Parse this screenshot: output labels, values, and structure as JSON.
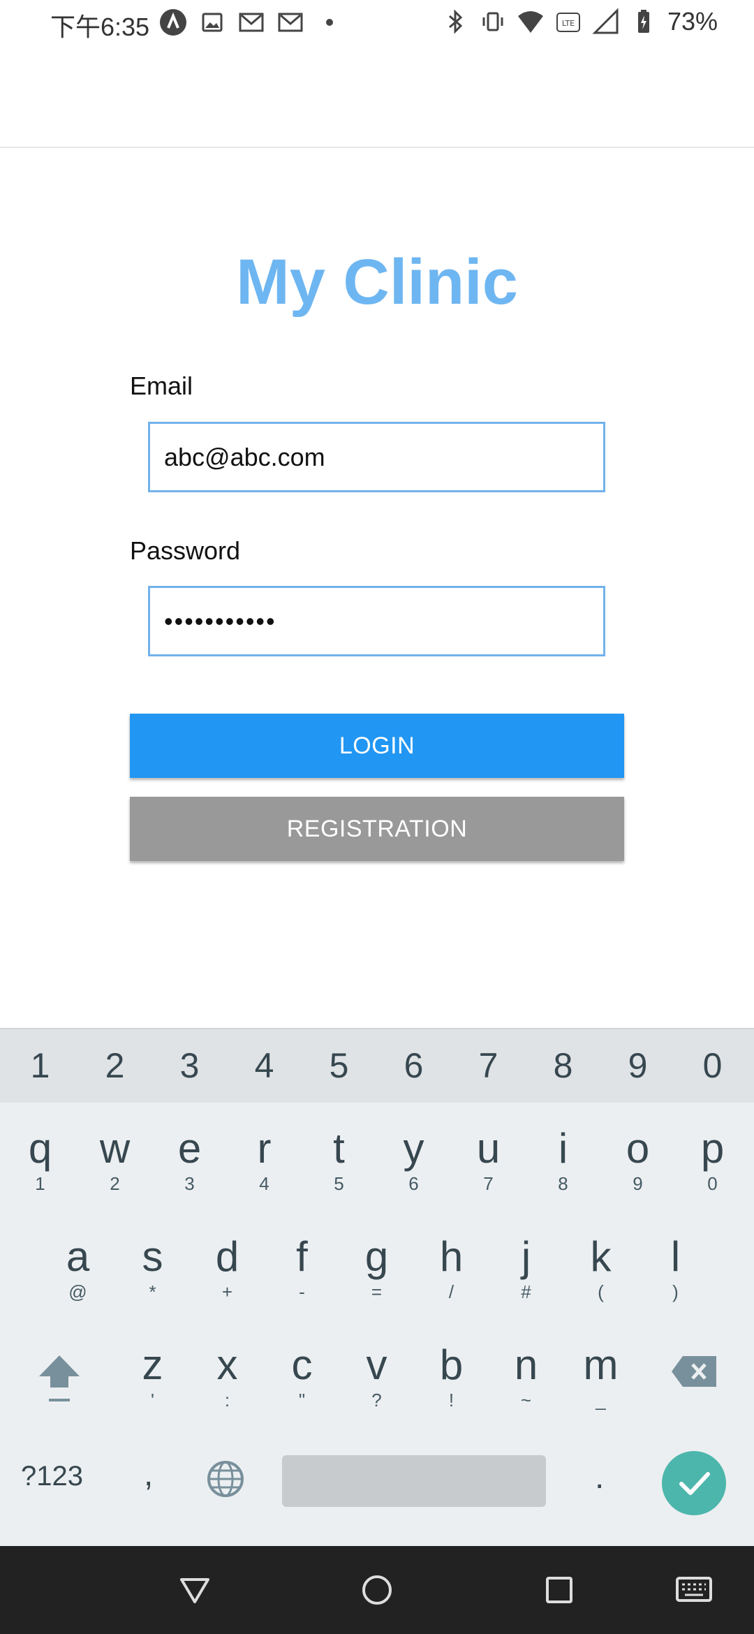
{
  "status_bar": {
    "time": "下午6:35",
    "battery": "73%",
    "left_icons": [
      "a-notification-icon",
      "image-icon",
      "gmail-icon",
      "gmail-icon",
      "dot-icon"
    ],
    "right_icons": [
      "bluetooth-icon",
      "vibrate-icon",
      "wifi-icon",
      "volte-icon",
      "signal-icon",
      "battery-icon"
    ]
  },
  "app": {
    "title": "My Clinic"
  },
  "form": {
    "email_label": "Email",
    "email_value": "abc@abc.com",
    "password_label": "Password",
    "password_value": "•••••••••••",
    "login_label": "LOGIN",
    "register_label": "REGISTRATION"
  },
  "keyboard": {
    "numbers": [
      "1",
      "2",
      "3",
      "4",
      "5",
      "6",
      "7",
      "8",
      "9",
      "0"
    ],
    "row1": [
      {
        "key": "q",
        "sub": "1"
      },
      {
        "key": "w",
        "sub": "2"
      },
      {
        "key": "e",
        "sub": "3"
      },
      {
        "key": "r",
        "sub": "4"
      },
      {
        "key": "t",
        "sub": "5"
      },
      {
        "key": "y",
        "sub": "6"
      },
      {
        "key": "u",
        "sub": "7"
      },
      {
        "key": "i",
        "sub": "8"
      },
      {
        "key": "o",
        "sub": "9"
      },
      {
        "key": "p",
        "sub": "0"
      }
    ],
    "row2": [
      {
        "key": "a",
        "sub": "@"
      },
      {
        "key": "s",
        "sub": "*"
      },
      {
        "key": "d",
        "sub": "+"
      },
      {
        "key": "f",
        "sub": "-"
      },
      {
        "key": "g",
        "sub": "="
      },
      {
        "key": "h",
        "sub": "/"
      },
      {
        "key": "j",
        "sub": "#"
      },
      {
        "key": "k",
        "sub": "("
      },
      {
        "key": "l",
        "sub": ")"
      }
    ],
    "row3": [
      {
        "key": "z",
        "sub": "'"
      },
      {
        "key": "x",
        "sub": ":"
      },
      {
        "key": "c",
        "sub": "\""
      },
      {
        "key": "v",
        "sub": "?"
      },
      {
        "key": "b",
        "sub": "!"
      },
      {
        "key": "n",
        "sub": "~"
      },
      {
        "key": "m",
        "sub": "_"
      }
    ],
    "symbols_label": "?123",
    "comma": ",",
    "period": "."
  },
  "colors": {
    "title": "#6eb6f1",
    "login": "#2196f3",
    "register": "#999999",
    "enter": "#4db6ac"
  }
}
